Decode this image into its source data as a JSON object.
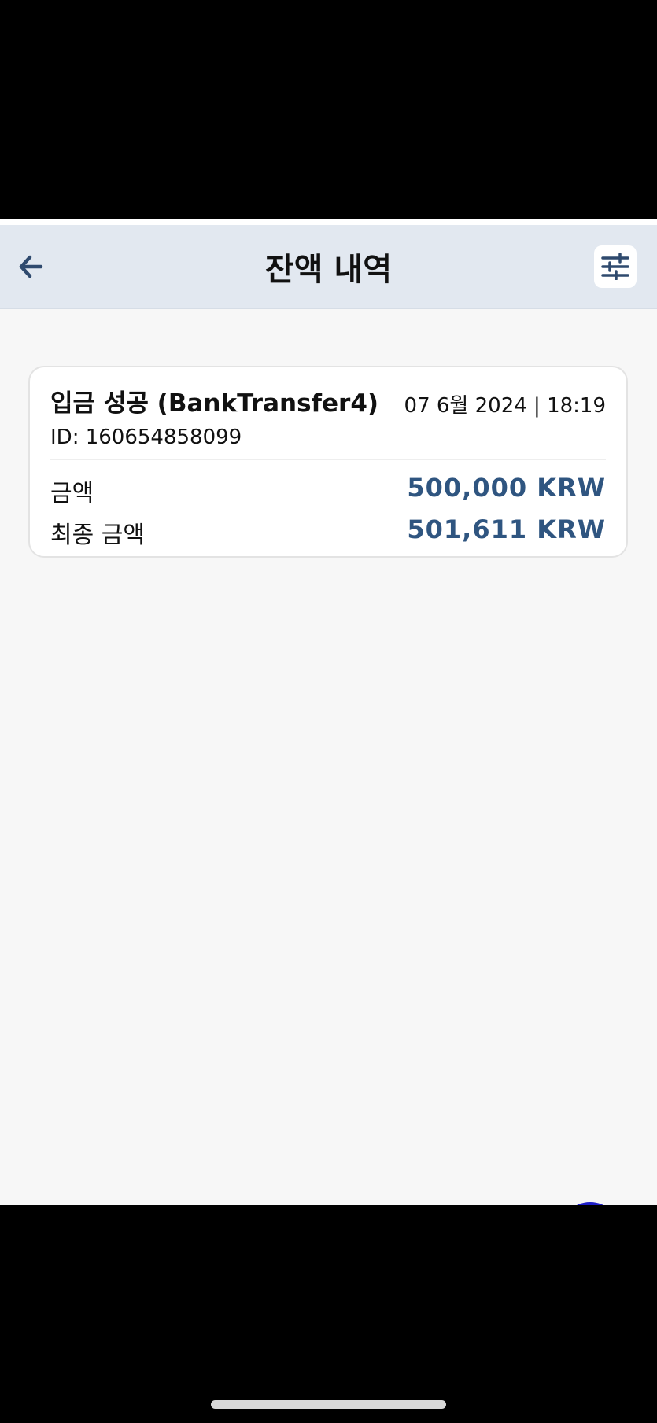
{
  "header": {
    "title": "잔액 내역",
    "back_icon": "arrow-left-icon",
    "filter_icon": "sliders-icon"
  },
  "transaction": {
    "title": "입금 성공 (BankTransfer4)",
    "date": "07 6월 2024 | 18:19",
    "id": "ID: 160654858099",
    "amount_label": "금액",
    "amount_value": "500,000 KRW",
    "final_label": "최종 금액",
    "final_value": "501,611 KRW"
  },
  "colors": {
    "header_bg": "#e2e8f0",
    "accent": "#2f5580",
    "page_bg": "#f7f7f7"
  }
}
